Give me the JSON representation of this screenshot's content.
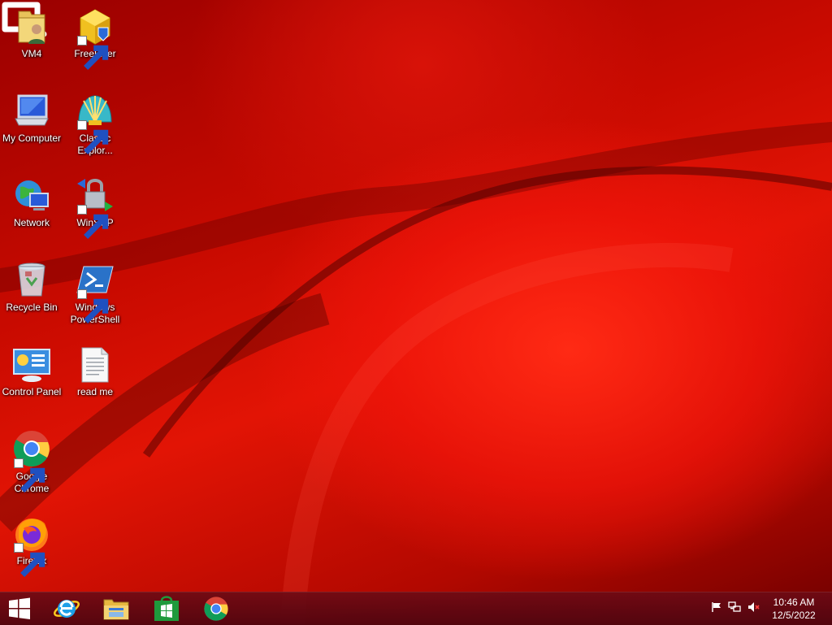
{
  "desktop": {
    "icons": [
      {
        "label": "VM4",
        "icon": "user-folder-icon"
      },
      {
        "label": "FreeFixer",
        "icon": "freefixer-icon"
      },
      {
        "label": "My Computer",
        "icon": "computer-icon"
      },
      {
        "label": "Classic Explor...",
        "icon": "classic-explorer-shell-icon"
      },
      {
        "label": "Network",
        "icon": "network-globe-icon"
      },
      {
        "label": "WinSCP",
        "icon": "winscp-lock-icon"
      },
      {
        "label": "Recycle Bin",
        "icon": "recycle-bin-icon"
      },
      {
        "label": "Windows PowerShell",
        "icon": "powershell-icon"
      },
      {
        "label": "Control Panel",
        "icon": "control-panel-icon"
      },
      {
        "label": "read me",
        "icon": "text-document-icon"
      },
      {
        "label": "Google Chrome",
        "icon": "chrome-icon"
      },
      {
        "label": "Firefox",
        "icon": "firefox-icon"
      }
    ]
  },
  "taskbar": {
    "pinned": [
      {
        "name": "start-button",
        "icon": "windows-logo-icon"
      },
      {
        "name": "internet-explorer",
        "icon": "internet-explorer-icon"
      },
      {
        "name": "file-explorer",
        "icon": "file-explorer-icon"
      },
      {
        "name": "windows-store",
        "icon": "store-icon"
      },
      {
        "name": "google-chrome",
        "icon": "chrome-icon"
      }
    ],
    "tray": {
      "icons": [
        "action-center-flag-icon",
        "network-icon",
        "volume-muted-icon"
      ],
      "time": "10:46 AM",
      "date": "12/5/2022"
    }
  },
  "colors": {
    "wallpaper_primary": "#e01408",
    "wallpaper_dark": "#7a0000",
    "taskbar": "#6a0a14"
  }
}
